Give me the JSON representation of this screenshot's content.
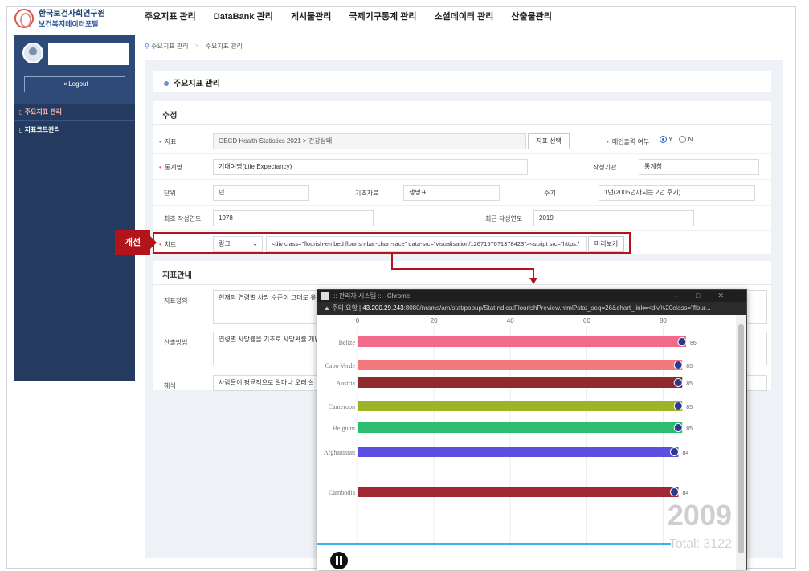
{
  "logo": {
    "line1": "한국보건사회연구원",
    "line2": "보건복지데이터포털"
  },
  "topnav": [
    "주요지표 관리",
    "DataBank 관리",
    "게시물관리",
    "국제기구통계 관리",
    "소셜데이터 관리",
    "산출물관리"
  ],
  "sidebar": {
    "logout": "Logout",
    "items": [
      {
        "label": "주요지표 관리"
      },
      {
        "label": "지표코드관리"
      }
    ]
  },
  "breadcrumb": [
    "주요지표 관리",
    "주요지표 관리"
  ],
  "section_title": "주요지표 관리",
  "edit": {
    "heading": "수정",
    "indicator_label": "지표",
    "indicator_value": "OECD Health Statistics 2021 > 건강상태",
    "select_button": "지표 선택",
    "main_output_label": "메인출력 여부",
    "radio_y": "Y",
    "radio_n": "N",
    "stat_name_label": "통계명",
    "stat_name_value": "기대여명(Life Expectancy)",
    "org_label": "작성기관",
    "org_value": "통계청",
    "unit_label": "단위",
    "unit_value": "년",
    "base_label": "기초자료",
    "base_value": "생명표",
    "cycle_label": "주기",
    "cycle_value": "1년(2005년까지는 2년 주기)",
    "first_year_label": "최초 작성연도",
    "first_year_value": "1978",
    "recent_year_label": "최근 작성연도",
    "recent_year_value": "2019",
    "chart_label": "차트",
    "chart_type": "링크",
    "chart_code": "<div class=\"flourish-embed flourish-bar-chart-race\" data-src=\"visualisation/12671570?1378423\"><script src=\"https:/",
    "preview_button": "미리보기"
  },
  "callout": "개선",
  "guide": {
    "heading": "지표안내",
    "def_label": "지표정의",
    "def_value": "현재의 연령별 사망 수준이 그대로 유지된",
    "method_label": "산출방법",
    "method_value": "연령별 사망률을 기초로 사망확률 개념에",
    "interp_label": "해석",
    "interp_value": "사람들이 평균적으로 얼마나 오래 살 것인"
  },
  "popup": {
    "title": ":: 관리자 시스템 :: - Chrome",
    "security": "주의 요함",
    "host": "43.200.29.243",
    "path": ":8080/nrams/am/stat/popup/StatIndicatFlourishPreview.html?stat_seq=26&chart_link=<div%20class=\"flour..."
  },
  "chart_data": {
    "type": "bar",
    "x_ticks": [
      0,
      20,
      40,
      60,
      80
    ],
    "xlim": [
      0,
      90
    ],
    "categories": [
      "Belize",
      "Cabo Verde",
      "Austria",
      "Cameroon",
      "Belgium",
      "Afghanistan",
      "Cambodia"
    ],
    "values": [
      86,
      85,
      85,
      85,
      85,
      84,
      84
    ],
    "colors": {
      "Belize": "#f26a8a",
      "Cabo Verde": "#f4797c",
      "Austria": "#8f2a2e",
      "Cameroon": "#9cb526",
      "Belgium": "#2ebd6e",
      "Afghanistan": "#5b4fe0",
      "Cambodia": "#a02833"
    },
    "year": "2009",
    "total": "Total: 3122"
  }
}
